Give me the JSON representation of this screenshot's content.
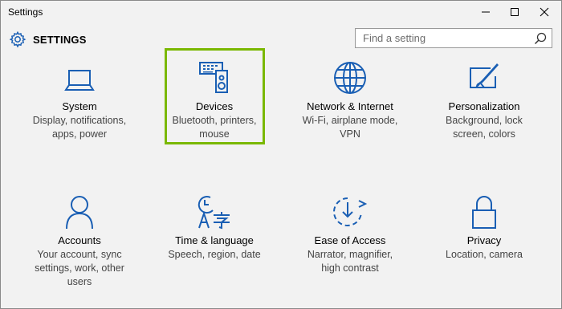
{
  "window": {
    "title": "Settings",
    "minimize_glyph": "—",
    "maximize_glyph": "☐",
    "close_glyph": "✕"
  },
  "header": {
    "icon": "gear-icon",
    "label": "SETTINGS"
  },
  "search": {
    "placeholder": "Find a setting",
    "value": "",
    "icon": "search-icon"
  },
  "accent_color": "#1a5fb4",
  "highlight_color": "#7ab800",
  "tiles": [
    {
      "name": "System",
      "desc": [
        "Display, notifications,",
        "apps, power"
      ],
      "icon": "laptop-icon"
    },
    {
      "name": "Devices",
      "desc": [
        "Bluetooth, printers,",
        "mouse"
      ],
      "icon": "devices-icon",
      "highlighted": true
    },
    {
      "name": "Network & Internet",
      "desc": [
        "Wi-Fi, airplane mode,",
        "VPN"
      ],
      "icon": "globe-icon"
    },
    {
      "name": "Personalization",
      "desc": [
        "Background, lock",
        "screen, colors"
      ],
      "icon": "paint-icon"
    },
    {
      "name": "Accounts",
      "desc": [
        "Your account, sync",
        "settings, work, other",
        "users"
      ],
      "icon": "person-icon"
    },
    {
      "name": "Time & language",
      "desc": [
        "Speech, region, date"
      ],
      "icon": "time-language-icon"
    },
    {
      "name": "Ease of Access",
      "desc": [
        "Narrator, magnifier,",
        "high contrast"
      ],
      "icon": "ease-of-access-icon"
    },
    {
      "name": "Privacy",
      "desc": [
        "Location, camera"
      ],
      "icon": "lock-icon"
    }
  ]
}
